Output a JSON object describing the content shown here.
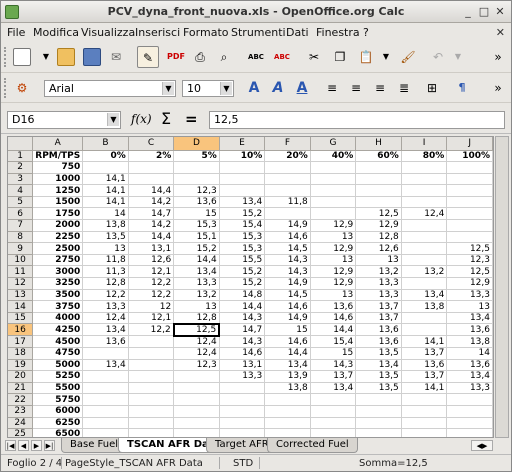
{
  "window": {
    "title": "PCV_dyna_front_nuova.xls - OpenOffice.org Calc"
  },
  "menu": [
    "File",
    "Modifica",
    "Visualizza",
    "Inserisci",
    "Formato",
    "Strumenti",
    "Dati",
    "Finestra",
    "?"
  ],
  "font": {
    "name": "Arial",
    "size": "10"
  },
  "formula": {
    "cell_ref": "D16",
    "value": "12,5"
  },
  "columns": [
    "A",
    "B",
    "C",
    "D",
    "E",
    "F",
    "G",
    "H",
    "I",
    "J"
  ],
  "rows": [
    [
      "RPM/TPS",
      "0%",
      "2%",
      "5%",
      "10%",
      "20%",
      "40%",
      "60%",
      "80%",
      "100%"
    ],
    [
      "750",
      "",
      "",
      "",
      "",
      "",
      "",
      "",
      "",
      ""
    ],
    [
      "1000",
      "14,1",
      "",
      "",
      "",
      "",
      "",
      "",
      "",
      ""
    ],
    [
      "1250",
      "14,1",
      "14,4",
      "12,3",
      "",
      "",
      "",
      "",
      "",
      ""
    ],
    [
      "1500",
      "14,1",
      "14,2",
      "13,6",
      "13,4",
      "11,8",
      "",
      "",
      "",
      ""
    ],
    [
      "1750",
      "14",
      "14,7",
      "15",
      "15,2",
      "",
      "",
      "12,5",
      "12,4",
      ""
    ],
    [
      "2000",
      "13,8",
      "14,2",
      "15,3",
      "15,4",
      "14,9",
      "12,9",
      "12,9",
      "",
      ""
    ],
    [
      "2250",
      "13,5",
      "14,4",
      "15,1",
      "15,3",
      "14,6",
      "13",
      "12,8",
      "",
      ""
    ],
    [
      "2500",
      "13",
      "13,1",
      "15,2",
      "15,3",
      "14,5",
      "12,9",
      "12,6",
      "",
      "12,5"
    ],
    [
      "2750",
      "11,8",
      "12,6",
      "14,4",
      "15,5",
      "14,3",
      "13",
      "13",
      "",
      "12,3"
    ],
    [
      "3000",
      "11,3",
      "12,1",
      "13,4",
      "15,2",
      "14,3",
      "12,9",
      "13,2",
      "13,2",
      "12,5"
    ],
    [
      "3250",
      "12,8",
      "12,2",
      "13,3",
      "15,2",
      "14,9",
      "12,9",
      "13,3",
      "",
      "12,9"
    ],
    [
      "3500",
      "12,2",
      "12,2",
      "13,2",
      "14,8",
      "14,5",
      "13",
      "13,3",
      "13,4",
      "13,3"
    ],
    [
      "3750",
      "13,3",
      "12",
      "13",
      "14,4",
      "14,6",
      "13,6",
      "13,7",
      "13,8",
      "13"
    ],
    [
      "4000",
      "12,4",
      "12,1",
      "12,8",
      "14,3",
      "14,9",
      "14,6",
      "13,7",
      "",
      "13,4"
    ],
    [
      "4250",
      "13,4",
      "12,2",
      "12,5",
      "14,7",
      "15",
      "14,4",
      "13,6",
      "",
      "13,6"
    ],
    [
      "4500",
      "13,6",
      "",
      "12,4",
      "14,3",
      "14,6",
      "15,4",
      "13,6",
      "14,1",
      "13,8"
    ],
    [
      "4750",
      "",
      "",
      "12,4",
      "14,6",
      "14,4",
      "15",
      "13,5",
      "13,7",
      "14"
    ],
    [
      "5000",
      "13,4",
      "",
      "12,3",
      "13,1",
      "13,4",
      "14,3",
      "13,4",
      "13,6",
      "13,6"
    ],
    [
      "5250",
      "",
      "",
      "",
      "13,3",
      "13,9",
      "13,7",
      "13,5",
      "13,7",
      "13,4"
    ],
    [
      "5500",
      "",
      "",
      "",
      "",
      "13,8",
      "13,4",
      "13,5",
      "14,1",
      "13,3"
    ],
    [
      "5750",
      "",
      "",
      "",
      "",
      "",
      "",
      "",
      "",
      ""
    ],
    [
      "6000",
      "",
      "",
      "",
      "",
      "",
      "",
      "",
      "",
      ""
    ],
    [
      "6250",
      "",
      "",
      "",
      "",
      "",
      "",
      "",
      "",
      ""
    ],
    [
      "6500",
      "",
      "",
      "",
      "",
      "",
      "",
      "",
      "",
      ""
    ]
  ],
  "tabs": [
    "Base Fuel",
    "TSCAN AFR Data",
    "Target AFR",
    "Corrected Fuel"
  ],
  "status": {
    "sheet": "Foglio 2 / 4",
    "style": "PageStyle_TSCAN AFR Data",
    "mode": "STD",
    "sum": "Somma=12,5"
  }
}
